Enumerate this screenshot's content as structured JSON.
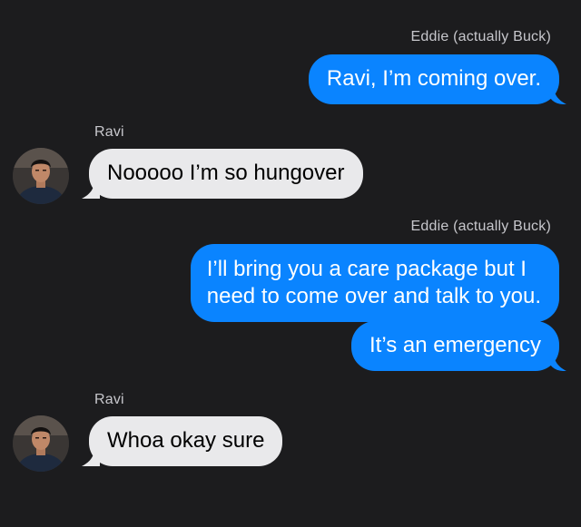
{
  "thread": {
    "messages": [
      {
        "sender": "Eddie (actually Buck)",
        "direction": "outgoing",
        "lines": [
          "Ravi, I’m coming over."
        ]
      },
      {
        "sender": "Ravi",
        "direction": "incoming",
        "lines": [
          "Nooooo I’m so hungover"
        ]
      },
      {
        "sender": "Eddie (actually Buck)",
        "direction": "outgoing",
        "lines": [
          "I’ll bring you a care package but I",
          "need to come over and talk to you."
        ]
      },
      {
        "sender": "Eddie (actually Buck)",
        "direction": "outgoing",
        "lines": [
          "It’s an emergency"
        ]
      },
      {
        "sender": "Ravi",
        "direction": "incoming",
        "lines": [
          "Whoa okay sure"
        ]
      }
    ]
  },
  "colors": {
    "background": "#1c1c1e",
    "outgoing_bubble": "#0a84ff",
    "incoming_bubble": "#e9e9eb",
    "sender_label": "#c7c7cc"
  },
  "icons": {
    "avatar": "contact-photo"
  }
}
